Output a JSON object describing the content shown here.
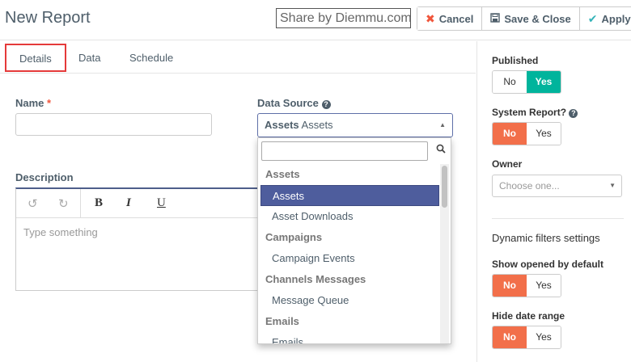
{
  "header": {
    "title": "New Report",
    "watermark": "Share by Diemmu.com",
    "cancel_label": "Cancel",
    "save_close_label": "Save & Close",
    "apply_label": "Apply"
  },
  "tabs": [
    {
      "label": "Details"
    },
    {
      "label": "Data"
    },
    {
      "label": "Schedule"
    }
  ],
  "form": {
    "name_label": "Name",
    "required_mark": "*",
    "name_value": "",
    "datasource_label": "Data Source",
    "datasource_selected_group": "Assets",
    "datasource_selected_item": "Assets",
    "description_label": "Description",
    "description_placeholder": "Type something"
  },
  "editor_toolbar": {
    "undo": "↺",
    "redo": "↻",
    "bold": "B",
    "italic": "I",
    "underline": "U"
  },
  "dropdown": {
    "search_value": "",
    "entries": [
      {
        "type": "group",
        "label": "Assets"
      },
      {
        "type": "item",
        "label": "Assets",
        "highlighted": true
      },
      {
        "type": "item",
        "label": "Asset Downloads"
      },
      {
        "type": "group",
        "label": "Campaigns"
      },
      {
        "type": "item",
        "label": "Campaign Events"
      },
      {
        "type": "group",
        "label": "Channels Messages"
      },
      {
        "type": "item",
        "label": "Message Queue"
      },
      {
        "type": "group",
        "label": "Emails"
      },
      {
        "type": "item",
        "label": "Emails"
      }
    ]
  },
  "right_panel": {
    "published_label": "Published",
    "published_no": "No",
    "published_yes": "Yes",
    "published_value": "Yes",
    "system_report_label": "System Report?",
    "system_no": "No",
    "system_yes": "Yes",
    "system_value": "No",
    "owner_label": "Owner",
    "owner_placeholder": "Choose one...",
    "dynamic_heading": "Dynamic filters settings",
    "show_opened_label": "Show opened by default",
    "show_no": "No",
    "show_yes": "Yes",
    "show_value": "No",
    "hide_date_label": "Hide date range",
    "hide_no": "No",
    "hide_yes": "Yes",
    "hide_value": "No"
  },
  "colors": {
    "accent_teal": "#00b49c",
    "accent_red": "#f26f4a",
    "highlight_blue": "#4e5d9d",
    "tab_outline": "#e53a3a"
  }
}
